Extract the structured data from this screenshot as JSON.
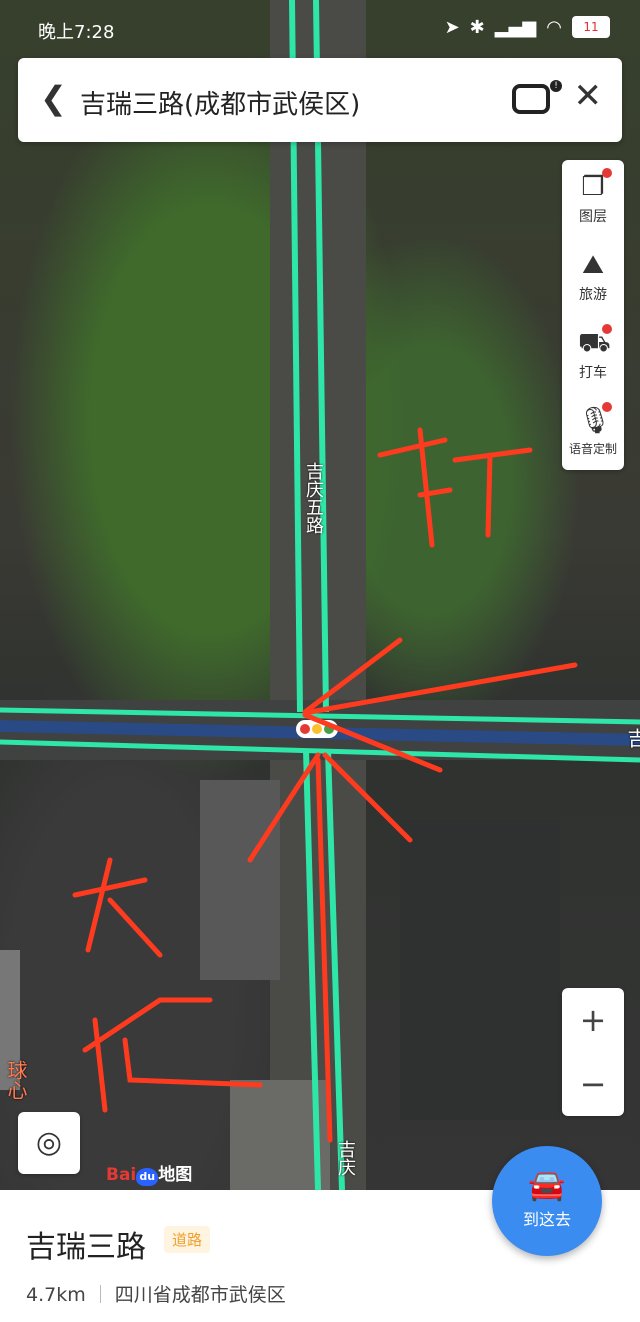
{
  "status_bar": {
    "time": "晚上7:28",
    "battery": "11"
  },
  "search_bar": {
    "title": "吉瑞三路(成都市武侯区)"
  },
  "tools": [
    {
      "label": "图层",
      "icon": "layers-icon"
    },
    {
      "label": "旅游",
      "icon": "travel-icon"
    },
    {
      "label": "打车",
      "icon": "taxi-icon"
    },
    {
      "label": "语音定制",
      "icon": "microphone-icon"
    }
  ],
  "zoom": {
    "in": "+",
    "out": "−"
  },
  "map_labels": {
    "road_north": "吉庆五路",
    "road_south": "吉庆",
    "east_edge": "吉",
    "west_edge": "球心"
  },
  "annotations": {
    "text_right": "开",
    "text_left": "太饥"
  },
  "logo": {
    "bai": "Bai",
    "du": "du",
    "suffix": "地图"
  },
  "place": {
    "name": "吉瑞三路",
    "tag": "道路",
    "distance": "4.7km",
    "address": "四川省成都市武侯区"
  },
  "go_button": {
    "label": "到这去"
  },
  "colors": {
    "road": "#2ee6a8",
    "annotation": "#ff3b1f",
    "button": "#3a8cf0"
  }
}
